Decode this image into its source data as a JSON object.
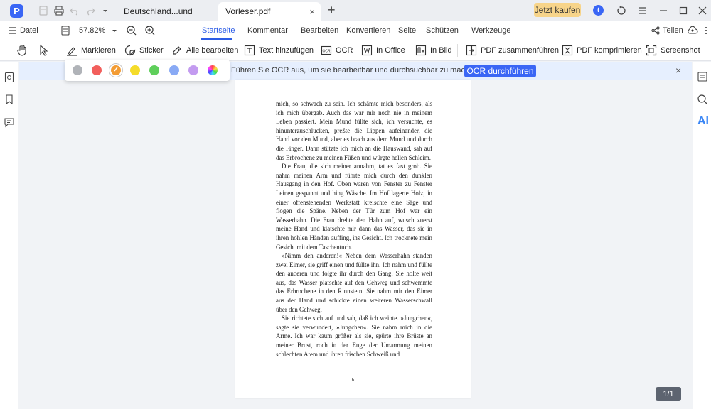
{
  "titlebar": {
    "app_logo": "P",
    "tabs": [
      {
        "label": "Deutschland...und fas.pdf",
        "active": false
      },
      {
        "label": "Vorleser.pdf",
        "active": true
      }
    ],
    "tab_close": "×",
    "new_tab": "+",
    "buy_label": "Jetzt kaufen",
    "avatar_letter": "t",
    "icons": [
      "home-icon",
      "print-icon",
      "undo-icon",
      "redo-icon",
      "dropdown-icon",
      "sync-icon",
      "hamburger-icon",
      "minimize-icon",
      "maximize-icon",
      "close-icon"
    ]
  },
  "menubar": {
    "file_label": "Datei",
    "zoom_value": "57.82%",
    "tabs": [
      "Startseite",
      "Kommentar",
      "Bearbeiten",
      "Konvertieren",
      "Seite",
      "Schützen",
      "Werkzeuge"
    ],
    "active_tab": "Startseite",
    "share_label": "Teilen"
  },
  "toolbar": {
    "tools": [
      {
        "label": "Markieren",
        "icon": "highlighter-icon"
      },
      {
        "label": "Sticker",
        "icon": "sticker-icon"
      },
      {
        "label": "Alle bearbeiten",
        "icon": "edit-all-icon"
      },
      {
        "label": "Text hinzufügen",
        "icon": "add-text-icon"
      },
      {
        "label": "OCR",
        "icon": "ocr-icon"
      },
      {
        "label": "In Office",
        "icon": "office-icon"
      },
      {
        "label": "In Bild",
        "icon": "image-icon"
      },
      {
        "label": "PDF zusammenführen",
        "icon": "merge-icon"
      },
      {
        "label": "PDF komprimieren",
        "icon": "compress-icon"
      },
      {
        "label": "Screenshot",
        "icon": "screenshot-icon"
      }
    ]
  },
  "colors": {
    "accent": "#2c5ce6",
    "buy": "#f7d48a",
    "swatches": [
      "#b0b3b8",
      "#f25f5c",
      "#f39c34",
      "#f5dc2a",
      "#5fcf5b",
      "#89aaf5",
      "#c39bf0"
    ],
    "selected_swatch": 2
  },
  "ocr_banner": {
    "text": "Führen Sie OCR aus, um sie bearbeitbar und durchsuchbar zu machen.",
    "button": "OCR durchführen",
    "close": "×"
  },
  "document": {
    "paragraphs": [
      "mich, so schwach zu sein. Ich schämte mich besonders, als ich mich übergab. Auch das war mir noch nie in meinem Leben passiert. Mein Mund füllte sich, ich versuchte, es hinunterzuschlucken, preßte die Lippen aufeinander, die Hand vor den Mund, aber es brach aus dem Mund und durch die Finger. Dann stützte ich mich an die Hauswand, sah auf das Erbrochene zu meinen Füßen und würgte hellen Schleim.",
      "Die Frau, die sich meiner annahm, tat es fast grob. Sie nahm meinen Arm und führte mich durch den dunklen Hausgang in den Hof. Oben waren von Fenster zu Fenster Leinen gespannt und hing Wäsche. Im Hof lagerte Holz; in einer offenstehenden Werkstatt kreischte eine Säge und flogen die Späne. Neben der Tür zum Hof war ein Wasserhahn. Die Frau drehte den Hahn auf, wusch zuerst meine Hand und klatschte mir dann das Wasser, das sie in ihren hohlen Händen auffing, ins Gesicht. Ich trocknete mein Gesicht mit dem Taschentuch.",
      "»Nimm den anderen!« Neben dem Wasserhahn standen zwei Eimer, sie griff einen und füllte ihn. Ich nahm und füllte den anderen und folgte ihr durch den Gang. Sie holte weit aus, das Wasser platschte auf den Gehweg und schwemmte das Erbrochene in den Rinnstein. Sie nahm mir den Eimer aus der Hand und schickte einen weiteren Wasserschwall über den Gehweg.",
      "Sie richtete sich auf und sah, daß ich weinte. »Jungchen«, sagte sie verwundert, »Jungchen«. Sie nahm mich in die Arme. Ich war kaum größer als sie, spürte ihre Brüste an meiner Brust, roch in der Enge der Umarmung meinen schlechten Atem und ihren frischen Schweiß und"
    ],
    "page_number": "6"
  },
  "page_counter": "1/1",
  "right_rail": {
    "ai_label": "AI"
  }
}
